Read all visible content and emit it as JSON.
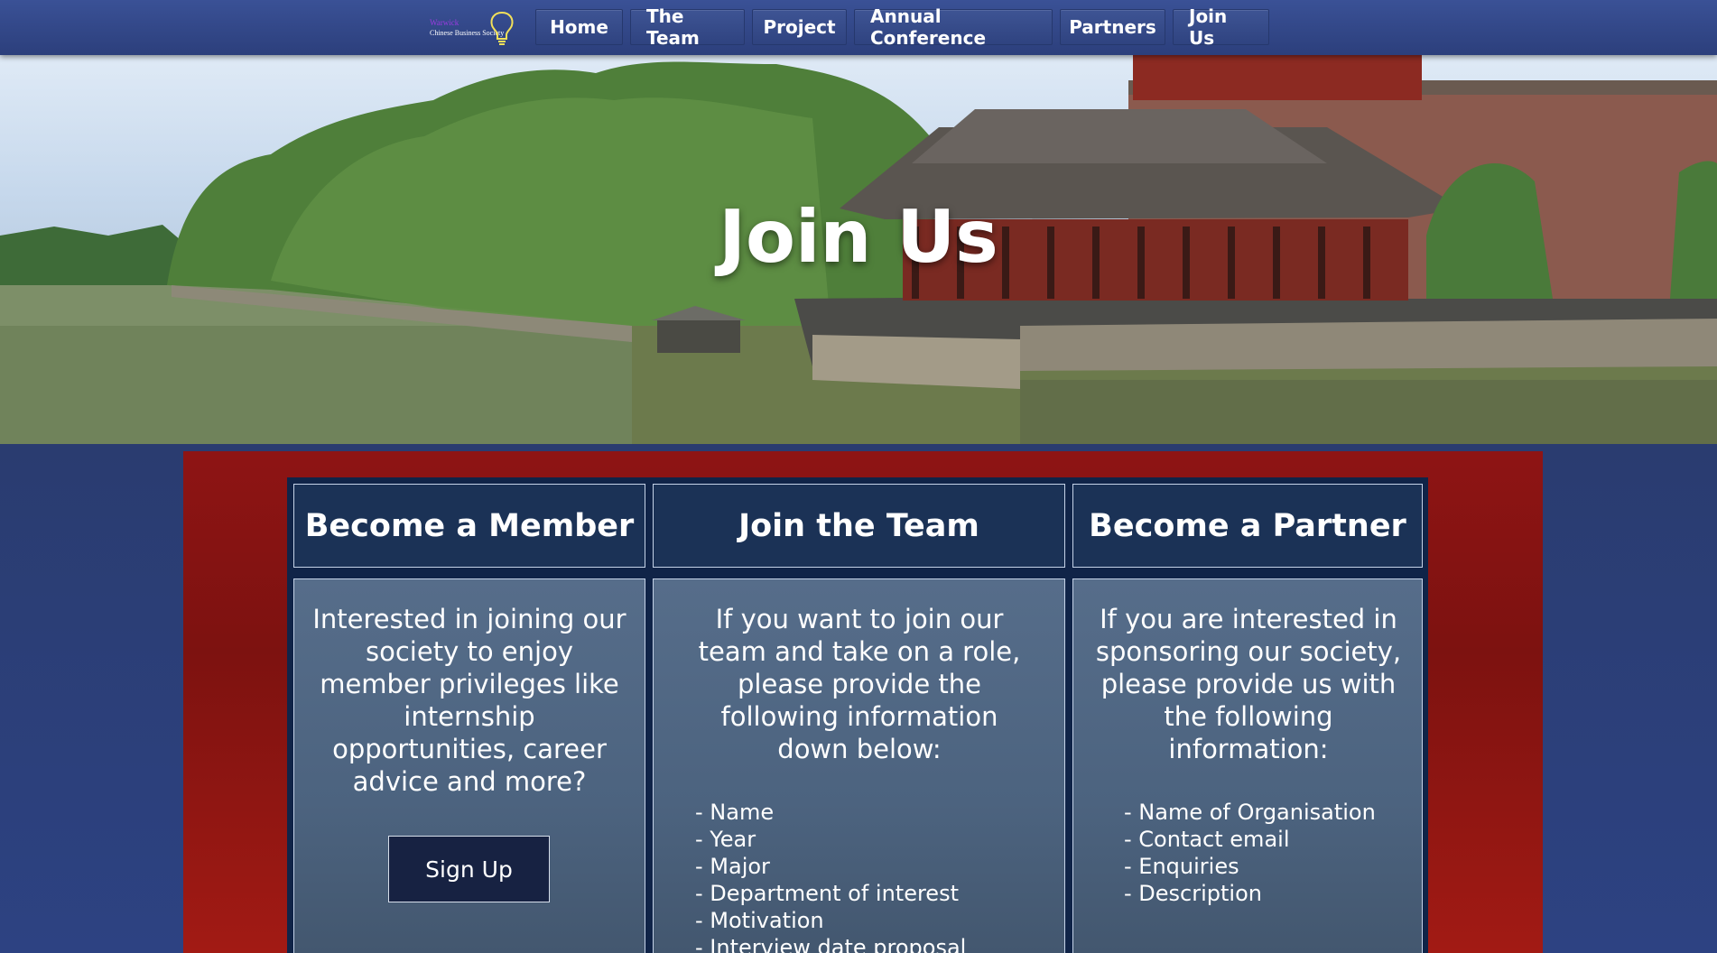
{
  "site": {
    "logo_line1": "Warwick",
    "logo_line2": "Chinese Business Society"
  },
  "nav": {
    "items": [
      "Home",
      "The Team",
      "Project",
      "Annual Conference",
      "Partners",
      "Join Us"
    ],
    "active": "Join Us"
  },
  "hero": {
    "title": "Join Us"
  },
  "cards": [
    {
      "heading": "Become a Member",
      "text": "Interested in joining our society to enjoy member privileges like internship opportunities, career advice and more?",
      "button": "Sign Up"
    },
    {
      "heading": "Join the Team",
      "text": "If you want to join our team and take on a role, please provide the following information down below:",
      "list": [
        "- Name",
        "- Year",
        "- Major",
        "- Department of interest",
        "- Motivation",
        "- Interview date proposal"
      ]
    },
    {
      "heading": "Become a Partner",
      "text": "If you are interested in sponsoring our society, please provide us with the following information:",
      "list": [
        "- Name of Organisation",
        "- Contact email",
        "- Enquiries",
        "- Description"
      ]
    }
  ],
  "colors": {
    "nav_bg": "#3a5196",
    "red_panel": "#8e1414",
    "card_head": "#1b3256",
    "card_body": "#566d8a",
    "logo_accent": "#9b3be0"
  }
}
